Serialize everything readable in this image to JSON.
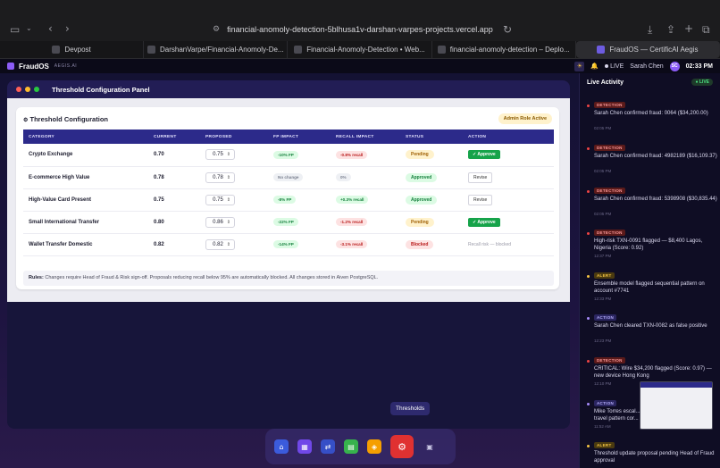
{
  "browser": {
    "url": "financial-anomoly-detection-5blhusa1v-darshan-varpes-projects.vercel.app",
    "tabs": [
      {
        "label": "Devpost"
      },
      {
        "label": "DarshanVarpe/Financial-Anomoly-De..."
      },
      {
        "label": "Financial-Anomoly-Detection • Web..."
      },
      {
        "label": "financial-anomoly-detection – Deplo..."
      },
      {
        "label": "FraudOS — CertificAI Aegis"
      }
    ]
  },
  "appbar": {
    "brand": "FraudOS",
    "brand_sub": "AEGIS.AI",
    "live": "LIVE",
    "user": "Sarah Chen",
    "avatar": "SC",
    "time": "02:33 PM"
  },
  "panel": {
    "title": "Threshold Configuration Panel",
    "card_title": "Threshold Configuration",
    "badge": "Admin Role Active",
    "columns": [
      "CATEGORY",
      "CURRENT",
      "PROPOSED",
      "FP IMPACT",
      "RECALL IMPACT",
      "STATUS",
      "ACTION"
    ],
    "rows": [
      {
        "category": "Crypto Exchange",
        "current": "0.70",
        "proposed": "0.75",
        "fp": "-10% FP",
        "recall": "-0.8% recall",
        "status": "Pending",
        "action": "✓ Approve"
      },
      {
        "category": "E-commerce High Value",
        "current": "0.78",
        "proposed": "0.78",
        "fp": "No change",
        "recall": "0%",
        "status": "Approved",
        "action": "Revise"
      },
      {
        "category": "High-Value Card Present",
        "current": "0.75",
        "proposed": "0.75",
        "fp": "-8% FP",
        "recall": "+0.3% recall",
        "status": "Approved",
        "action": "Revise"
      },
      {
        "category": "Small International Transfer",
        "current": "0.80",
        "proposed": "0.86",
        "fp": "-22% FP",
        "recall": "-1.2% recall",
        "status": "Pending",
        "action": "✓ Approve"
      },
      {
        "category": "Wallet Transfer Domestic",
        "current": "0.82",
        "proposed": "0.82",
        "fp": "-14% FP",
        "recall": "-3.1% recall",
        "status": "Blocked",
        "action": "Recall risk — blocked"
      }
    ],
    "rules_label": "Rules:",
    "rules_text": "Changes require Head of Fraud & Risk sign-off. Proposals reducing recall below 95% are automatically blocked. All changes stored in Aiven PostgreSQL."
  },
  "dock": {
    "tooltip": "Thresholds"
  },
  "sidebar": {
    "title": "Live Activity",
    "live": "● LIVE",
    "events": [
      {
        "tag": "DETECTION",
        "text": "Sarah Chen confirmed fraud: 0064 ($34,200.00)",
        "time": "02:05 PM"
      },
      {
        "tag": "DETECTION",
        "text": "Sarah Chen confirmed fraud: 4982189 ($16,109.37)",
        "time": "02:05 PM"
      },
      {
        "tag": "DETECTION",
        "text": "Sarah Chen confirmed fraud: 5398908 ($30,835.44)",
        "time": "02:05 PM"
      },
      {
        "tag": "DETECTION",
        "text": "High-risk TXN-0091 flagged — $8,400 Lagos, Nigeria (Score: 0.92)",
        "time": "12:37 PM"
      },
      {
        "tag": "ALERT",
        "text": "Ensemble model flagged sequential pattern on account #7741",
        "time": "12:33 PM"
      },
      {
        "tag": "ACTION",
        "text": "Sarah Chen cleared TXN-0082 as false positive",
        "time": "12:23 PM"
      },
      {
        "tag": "DETECTION",
        "text": "CRITICAL: Wire $34,200 flagged (Score: 0.97) — new device Hong Kong",
        "time": "12:10 PM"
      },
      {
        "tag": "ACTION",
        "text": "Mike Torres escal... travel pattern cor...",
        "time": "11:52 AM"
      },
      {
        "tag": "ALERT",
        "text": "Threshold update proposal pending Head of Fraud approval",
        "time": ""
      }
    ]
  },
  "colors": {
    "accent": "#8b5cf6",
    "table_header": "#2c2a8a",
    "approve": "#16a34a"
  }
}
